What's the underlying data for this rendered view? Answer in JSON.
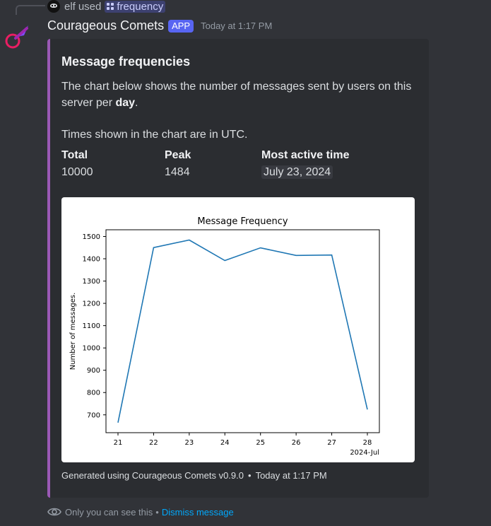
{
  "reply": {
    "user": "elf",
    "used_text": "used",
    "command": "frequency"
  },
  "message": {
    "author": "Courageous Comets",
    "badge": "APP",
    "timestamp": "Today at 1:17 PM"
  },
  "embed": {
    "accent_color": "#9b59b6",
    "title": "Message frequencies",
    "desc_before": "The chart below shows the number of messages sent by users on this server per ",
    "desc_bold": "day",
    "desc_after": ".",
    "desc_p2": "Times shown in the chart are in UTC.",
    "fields": [
      {
        "name": "Total",
        "value": "10000"
      },
      {
        "name": "Peak",
        "value": "1484"
      },
      {
        "name": "Most active time",
        "value": "July 23, 2024"
      }
    ],
    "footer_text": "Generated using Courageous Comets v0.9.0",
    "footer_time": "Today at 1:17 PM"
  },
  "ephemeral": {
    "notice": "Only you can see this",
    "separator": "•",
    "dismiss": "Dismiss message"
  },
  "chart_data": {
    "type": "line",
    "title": "Message Frequency",
    "ylabel": "Number of messages.",
    "xlabel": "",
    "x_offset_label": "2024-Jul",
    "categories": [
      "21",
      "22",
      "23",
      "24",
      "25",
      "26",
      "27",
      "28"
    ],
    "values": [
      665,
      1450,
      1484,
      1392,
      1449,
      1415,
      1417,
      724
    ],
    "ylim": [
      620,
      1530
    ],
    "yticks": [
      700,
      800,
      900,
      1000,
      1100,
      1200,
      1300,
      1400,
      1500
    ],
    "line_color": "#1f77b4",
    "grid": false
  }
}
